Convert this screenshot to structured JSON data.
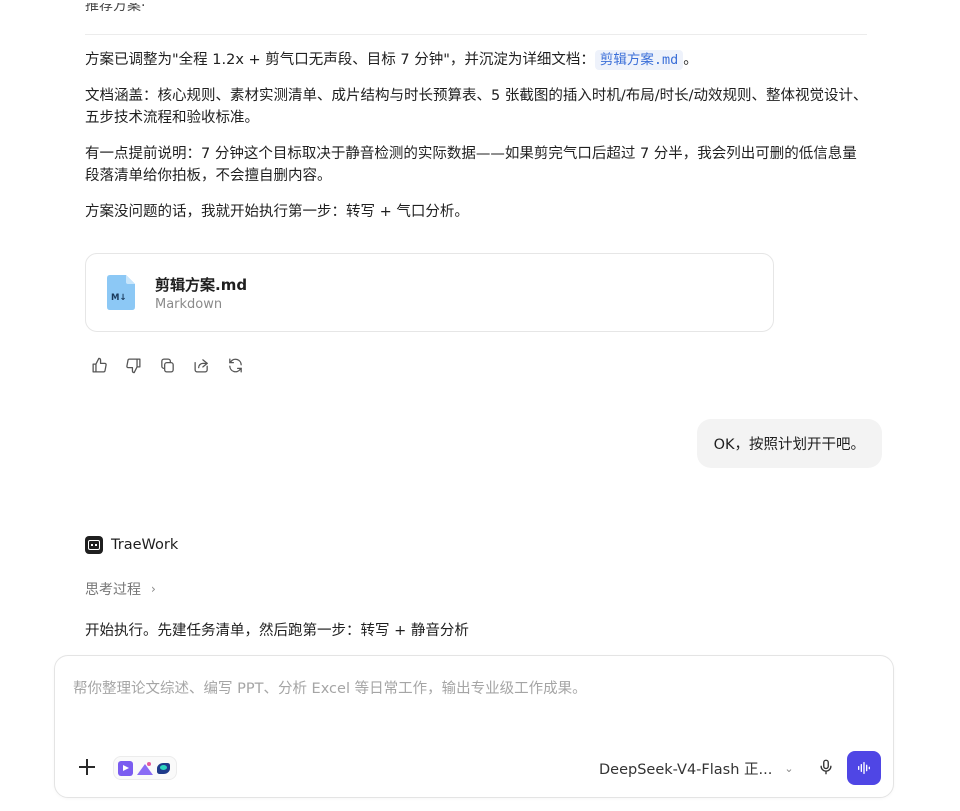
{
  "conversation": {
    "cut_top_text": "推荐方案·",
    "assistant_message": {
      "p1_before": "方案已调整为\"全程 1.2x + 剪气口无声段、目标 7 分钟\"，并沉淀为详细文档：",
      "p1_link": "剪辑方案.md",
      "p1_after": "。",
      "p2": "文档涵盖：核心规则、素材实测清单、成片结构与时长预算表、5 张截图的插入时机/布局/时长/动效规则、整体视觉设计、五步技术流程和验收标准。",
      "p3": "有一点提前说明：7 分钟这个目标取决于静音检测的实际数据——如果剪完气口后超过 7 分半，我会列出可删的低信息量段落清单给你拍板，不会擅自删内容。",
      "p4": "方案没问题的话，我就开始执行第一步：转写 + 气口分析。",
      "file_card": {
        "name": "剪辑方案.md",
        "type": "Markdown",
        "icon": "markdown-file-icon",
        "icon_color": "#8cc8f5"
      },
      "actions": [
        "thumbs-up-icon",
        "thumbs-down-icon",
        "copy-icon",
        "share-icon",
        "regenerate-icon"
      ]
    },
    "user_message": "OK，按照计划开干吧。",
    "agent": {
      "name": "TraeWork",
      "thinking_label": "思考过程",
      "stream_text": "开始执行。先建任务清单，然后跑第一步：转写 + 静音分析"
    }
  },
  "composer": {
    "placeholder": "帮你整理论文综述、编写 PPT、分析 Excel 等日常工作，输出专业级工作成果。",
    "model_label": "DeepSeek-V4-Flash 正...",
    "send_color": "#4f46e5"
  }
}
